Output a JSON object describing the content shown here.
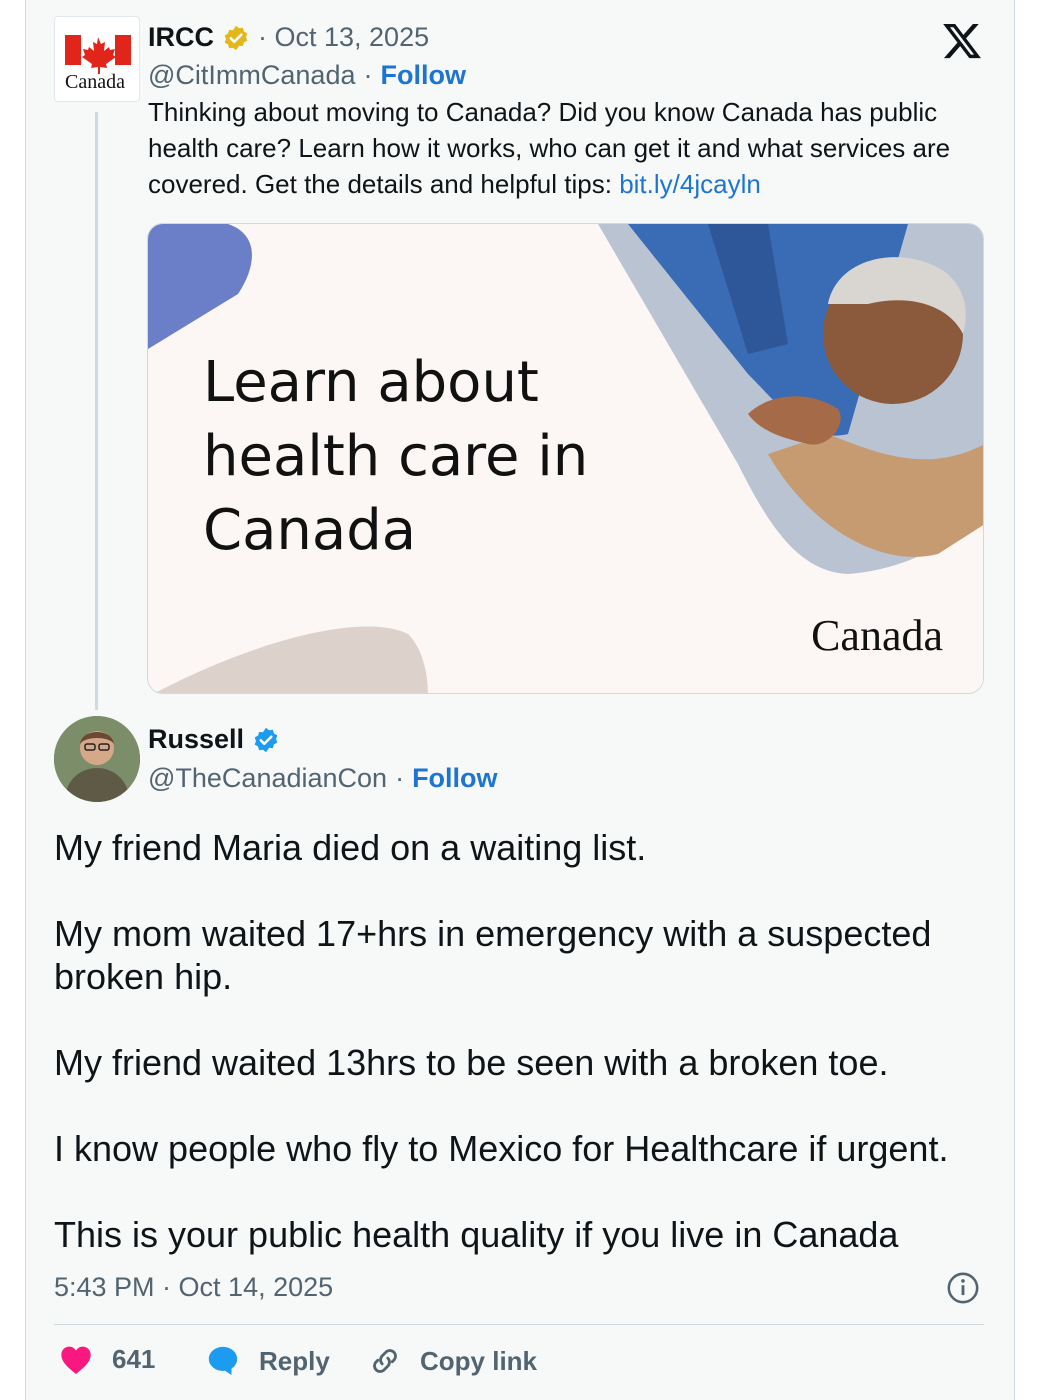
{
  "brand": {
    "x_logo": "x-logo-icon",
    "accent": "#1d9bf0"
  },
  "parent_tweet": {
    "author_name": "IRCC",
    "date": "· Oct 13, 2025",
    "handle": "@CitImmCanada",
    "separator": "·",
    "follow_label": "Follow",
    "text_main": "Thinking about moving to Canada? Did you know Canada has public health care? Learn how it works, who can get it and what services are covered. Get the details and helpful tips: ",
    "link_text": "bit.ly/4jcayln",
    "avatar_wordmark": "Canada",
    "media": {
      "headline": "Learn about health care in Canada",
      "wordmark": "Canada"
    }
  },
  "reply_tweet": {
    "author_name": "Russell",
    "handle": "@TheCanadianCon",
    "separator": "·",
    "follow_label": "Follow",
    "text": "My friend Maria died on a waiting list.\n\nMy mom waited 17+hrs in emergency with a suspected broken hip.\n\nMy friend waited 13hrs to be seen with a broken toe.\n\nI know people who fly to Mexico for Healthcare if urgent.\n\nThis is your public health quality if you live in Canada",
    "timestamp": "5:43 PM · Oct 14, 2025"
  },
  "actions": {
    "like_count": "641",
    "reply_label": "Reply",
    "copy_label": "Copy link"
  },
  "colors": {
    "like": "#f91880",
    "reply": "#1d9bf0",
    "verified_gold": "#e2b719",
    "verified_blue": "#1d9bf0"
  }
}
